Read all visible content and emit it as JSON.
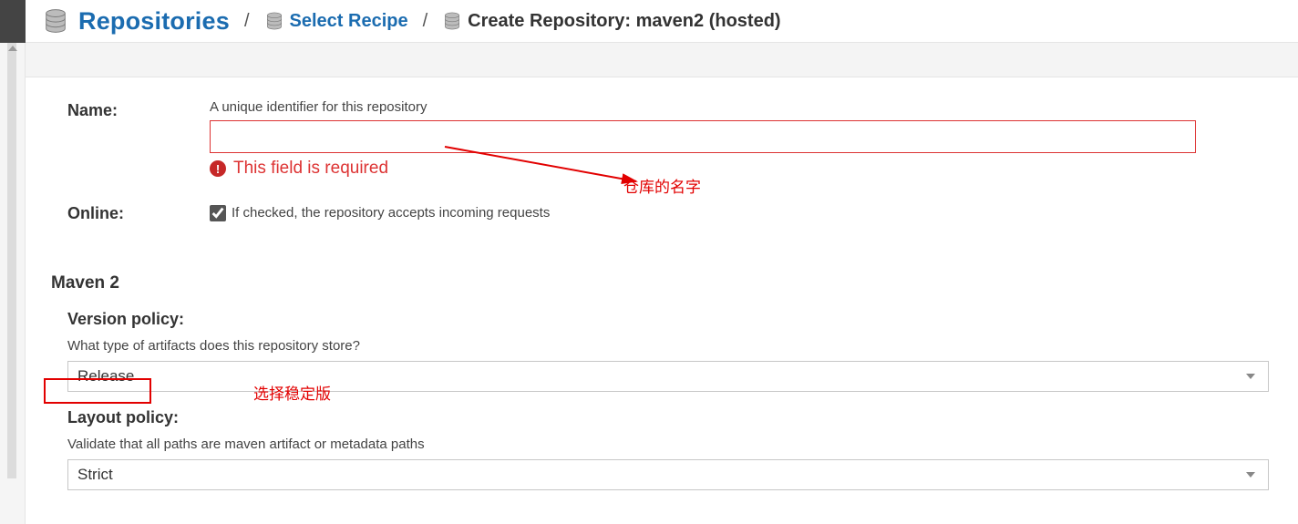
{
  "breadcrumb": {
    "repositories_label": "Repositories",
    "select_recipe_label": "Select Recipe",
    "current_label": "Create Repository: maven2 (hosted)"
  },
  "name_field": {
    "label": "Name:",
    "description": "A unique identifier for this repository",
    "value": "",
    "error": "This field is required"
  },
  "online_field": {
    "label": "Online:",
    "checked": true,
    "description": "If checked, the repository accepts incoming requests"
  },
  "section": {
    "title": "Maven 2"
  },
  "version_policy": {
    "label": "Version policy:",
    "description": "What type of artifacts does this repository store?",
    "value": "Release"
  },
  "layout_policy": {
    "label": "Layout policy:",
    "description": "Validate that all paths are maven artifact or metadata paths",
    "value": "Strict"
  },
  "annotations": {
    "name_annotation": "仓库的名字",
    "version_annotation": "选择稳定版"
  }
}
